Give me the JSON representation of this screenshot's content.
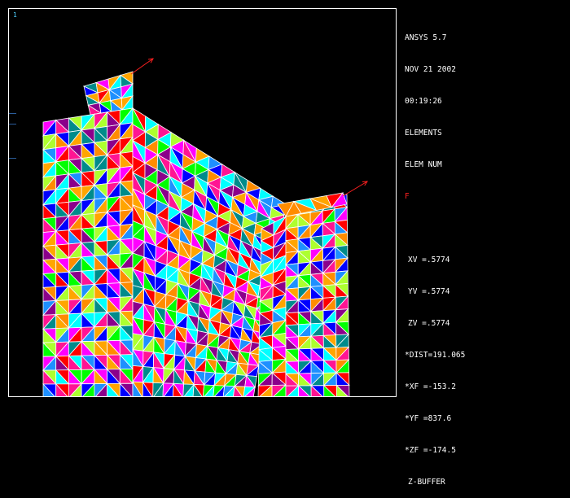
{
  "viewport": {
    "window_number": "1"
  },
  "info": {
    "product": "ANSYS 5.7",
    "date": "NOV 21 2002",
    "time": "00:19:26",
    "plot_type": "ELEMENTS",
    "label_mode": "ELEM NUM",
    "load_symbol": "F",
    "view": [
      "XV =.5774",
      "YV =.5774",
      "ZV =.5774",
      "*DIST=191.065",
      "*XF =-153.2",
      "*YF =837.6",
      "*ZF =-174.5",
      "Z-BUFFER"
    ]
  },
  "colors": {
    "background": "#000000",
    "edge": "#ffffff",
    "force_arrow": "#ff2020",
    "palette": [
      "#ff0000",
      "#0000ff",
      "#00ffff",
      "#ff00ff",
      "#adff2f",
      "#ffa500",
      "#008b8b",
      "#ff1493",
      "#00ff00",
      "#ff8c00",
      "#8b008b",
      "#1e90ff"
    ]
  }
}
